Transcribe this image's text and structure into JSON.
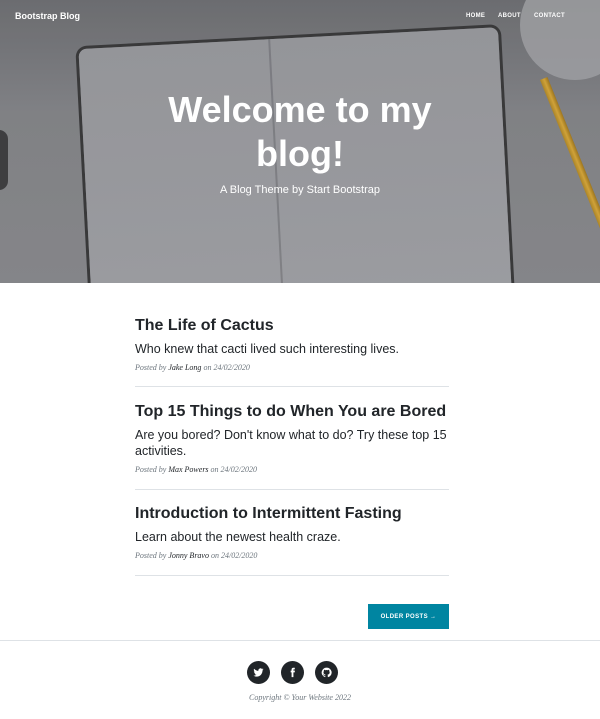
{
  "navbar": {
    "brand": "Bootstrap Blog",
    "links": [
      "HOME",
      "ABOUT",
      "CONTACT"
    ]
  },
  "hero": {
    "title": "Welcome to my blog!",
    "subtitle": "A Blog Theme by Start Bootstrap"
  },
  "posts": [
    {
      "title": "The Life of Cactus",
      "subtitle": "Who knew that cacti lived such interesting lives.",
      "meta_prefix": "Posted by",
      "author": "Jake Long",
      "meta_on": "on",
      "date": "24/02/2020"
    },
    {
      "title": "Top 15 Things to do When You are Bored",
      "subtitle": "Are you bored? Don't know what to do? Try these top 15 activities.",
      "meta_prefix": "Posted by",
      "author": "Max Powers",
      "meta_on": "on",
      "date": "24/02/2020"
    },
    {
      "title": "Introduction to Intermittent Fasting",
      "subtitle": "Learn about the newest health craze.",
      "meta_prefix": "Posted by",
      "author": "Jonny Bravo",
      "meta_on": "on",
      "date": "24/02/2020"
    }
  ],
  "pager": {
    "older_label": "OLDER POSTS →"
  },
  "footer": {
    "social_icons": [
      "twitter-icon",
      "facebook-icon",
      "github-icon"
    ],
    "copyright": "Copyright © Your Website 2022"
  },
  "colors": {
    "accent": "#0085a1",
    "text": "#212529",
    "muted": "#6c757d"
  }
}
